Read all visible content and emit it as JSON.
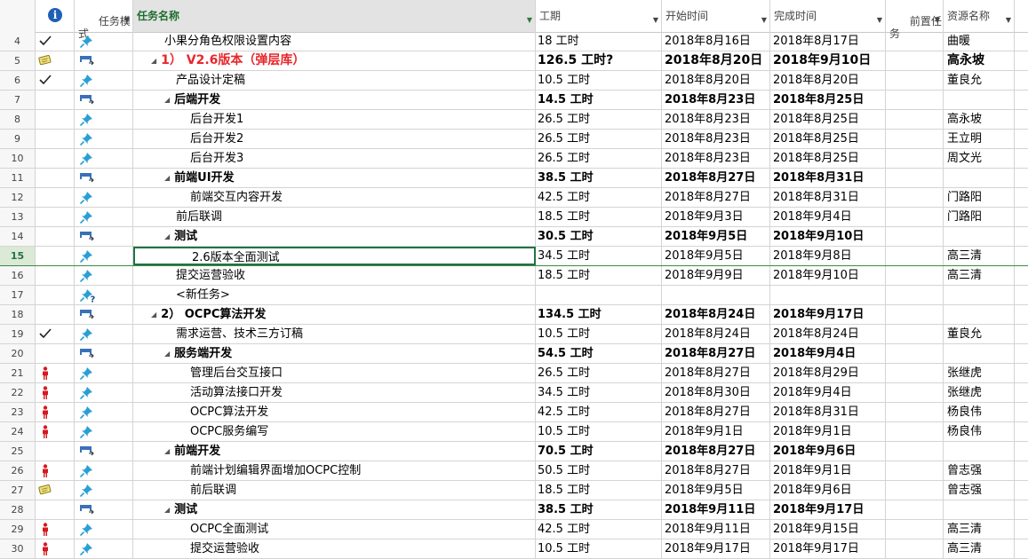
{
  "headers": {
    "info": "i",
    "mode": "任务模\n式",
    "name": "任务名称",
    "duration": "工期",
    "start": "开始时间",
    "finish": "完成时间",
    "pred": "前置任\n务",
    "resource": "资源名称"
  },
  "selected_row": 15,
  "rows": [
    {
      "id": "4",
      "ind": "check",
      "mode": "manual",
      "indent": 2,
      "tri": false,
      "name": "小果分角色权限设置内容",
      "dur": "18 工时",
      "start": "2018年8月16日",
      "fin": "2018年8月17日",
      "res": "曲暖",
      "style": "normal"
    },
    {
      "id": "5",
      "ind": "note",
      "mode": "summary",
      "indent": 1,
      "tri": true,
      "name": "1） V2.6版本（弹层库）",
      "dur": "126.5 工时?",
      "start": "2018年8月20日",
      "fin": "2018年9月10日",
      "res": "高永坡",
      "style": "big"
    },
    {
      "id": "6",
      "ind": "check",
      "mode": "manual",
      "indent": 3,
      "tri": false,
      "name": "产品设计定稿",
      "dur": "10.5 工时",
      "start": "2018年8月20日",
      "fin": "2018年8月20日",
      "res": "董良允",
      "style": "normal"
    },
    {
      "id": "7",
      "ind": "",
      "mode": "summary",
      "indent": 2,
      "tri": true,
      "name": "后端开发",
      "dur": "14.5 工时",
      "start": "2018年8月23日",
      "fin": "2018年8月25日",
      "res": "",
      "style": "bold"
    },
    {
      "id": "8",
      "ind": "",
      "mode": "manual",
      "indent": 4,
      "tri": false,
      "name": "后台开发1",
      "dur": "26.5 工时",
      "start": "2018年8月23日",
      "fin": "2018年8月25日",
      "res": "高永坡",
      "style": "normal"
    },
    {
      "id": "9",
      "ind": "",
      "mode": "manual",
      "indent": 4,
      "tri": false,
      "name": "后台开发2",
      "dur": "26.5 工时",
      "start": "2018年8月23日",
      "fin": "2018年8月25日",
      "res": "王立明",
      "style": "normal"
    },
    {
      "id": "10",
      "ind": "",
      "mode": "manual",
      "indent": 4,
      "tri": false,
      "name": "后台开发3",
      "dur": "26.5 工时",
      "start": "2018年8月23日",
      "fin": "2018年8月25日",
      "res": "周文光",
      "style": "normal"
    },
    {
      "id": "11",
      "ind": "",
      "mode": "summary",
      "indent": 2,
      "tri": true,
      "name": "前端UI开发",
      "dur": "38.5 工时",
      "start": "2018年8月27日",
      "fin": "2018年8月31日",
      "res": "",
      "style": "bold"
    },
    {
      "id": "12",
      "ind": "",
      "mode": "manual",
      "indent": 4,
      "tri": false,
      "name": "前端交互内容开发",
      "dur": "42.5 工时",
      "start": "2018年8月27日",
      "fin": "2018年8月31日",
      "res": "门路阳",
      "style": "normal"
    },
    {
      "id": "13",
      "ind": "",
      "mode": "manual",
      "indent": 3,
      "tri": false,
      "name": "前后联调",
      "dur": "18.5 工时",
      "start": "2018年9月3日",
      "fin": "2018年9月4日",
      "res": "门路阳",
      "style": "normal"
    },
    {
      "id": "14",
      "ind": "",
      "mode": "summary",
      "indent": 2,
      "tri": true,
      "name": "测试",
      "dur": "30.5 工时",
      "start": "2018年9月5日",
      "fin": "2018年9月10日",
      "res": "",
      "style": "bold"
    },
    {
      "id": "15",
      "ind": "",
      "mode": "manual",
      "indent": 4,
      "tri": false,
      "name": "2.6版本全面测试",
      "dur": "34.5 工时",
      "start": "2018年9月5日",
      "fin": "2018年9月8日",
      "res": "高三清",
      "style": "normal"
    },
    {
      "id": "16",
      "ind": "",
      "mode": "manual",
      "indent": 3,
      "tri": false,
      "name": "提交运营验收",
      "dur": "18.5 工时",
      "start": "2018年9月9日",
      "fin": "2018年9月10日",
      "res": "高三清",
      "style": "normal"
    },
    {
      "id": "17",
      "ind": "",
      "mode": "newtask",
      "indent": 3,
      "tri": false,
      "name": "<新任务>",
      "dur": "",
      "start": "",
      "fin": "",
      "res": "",
      "style": "normal"
    },
    {
      "id": "18",
      "ind": "",
      "mode": "summary",
      "indent": 1,
      "tri": true,
      "name": "2） OCPC算法开发",
      "dur": "134.5 工时",
      "start": "2018年8月24日",
      "fin": "2018年9月17日",
      "res": "",
      "style": "bold"
    },
    {
      "id": "19",
      "ind": "check",
      "mode": "manual",
      "indent": 3,
      "tri": false,
      "name": "需求运营、技术三方订稿",
      "dur": "10.5 工时",
      "start": "2018年8月24日",
      "fin": "2018年8月24日",
      "res": "董良允",
      "style": "normal"
    },
    {
      "id": "20",
      "ind": "",
      "mode": "summary",
      "indent": 2,
      "tri": true,
      "name": "服务端开发",
      "dur": "54.5 工时",
      "start": "2018年8月27日",
      "fin": "2018年9月4日",
      "res": "",
      "style": "bold"
    },
    {
      "id": "21",
      "ind": "person",
      "mode": "manual",
      "indent": 4,
      "tri": false,
      "name": "管理后台交互接口",
      "dur": "26.5 工时",
      "start": "2018年8月27日",
      "fin": "2018年8月29日",
      "res": "张继虎",
      "style": "normal"
    },
    {
      "id": "22",
      "ind": "person",
      "mode": "manual",
      "indent": 4,
      "tri": false,
      "name": "活动算法接口开发",
      "dur": "34.5 工时",
      "start": "2018年8月30日",
      "fin": "2018年9月4日",
      "res": "张继虎",
      "style": "normal"
    },
    {
      "id": "23",
      "ind": "person",
      "mode": "manual",
      "indent": 4,
      "tri": false,
      "name": "OCPC算法开发",
      "dur": "42.5 工时",
      "start": "2018年8月27日",
      "fin": "2018年8月31日",
      "res": "杨良伟",
      "style": "normal"
    },
    {
      "id": "24",
      "ind": "person",
      "mode": "manual",
      "indent": 4,
      "tri": false,
      "name": "OCPC服务编写",
      "dur": "10.5 工时",
      "start": "2018年9月1日",
      "fin": "2018年9月1日",
      "res": "杨良伟",
      "style": "normal"
    },
    {
      "id": "25",
      "ind": "",
      "mode": "summary",
      "indent": 2,
      "tri": true,
      "name": "前端开发",
      "dur": "70.5 工时",
      "start": "2018年8月27日",
      "fin": "2018年9月6日",
      "res": "",
      "style": "bold"
    },
    {
      "id": "26",
      "ind": "person",
      "mode": "manual",
      "indent": 4,
      "tri": false,
      "name": "前端计划编辑界面增加OCPC控制",
      "dur": "50.5 工时",
      "start": "2018年8月27日",
      "fin": "2018年9月1日",
      "res": "曾志强",
      "style": "normal"
    },
    {
      "id": "27",
      "ind": "note",
      "mode": "manual",
      "indent": 4,
      "tri": false,
      "name": "前后联调",
      "dur": "18.5 工时",
      "start": "2018年9月5日",
      "fin": "2018年9月6日",
      "res": "曾志强",
      "style": "normal"
    },
    {
      "id": "28",
      "ind": "",
      "mode": "summary",
      "indent": 2,
      "tri": true,
      "name": "测试",
      "dur": "38.5 工时",
      "start": "2018年9月11日",
      "fin": "2018年9月17日",
      "res": "",
      "style": "bold"
    },
    {
      "id": "29",
      "ind": "person",
      "mode": "manual",
      "indent": 4,
      "tri": false,
      "name": "OCPC全面测试",
      "dur": "42.5 工时",
      "start": "2018年9月11日",
      "fin": "2018年9月15日",
      "res": "高三清",
      "style": "normal"
    },
    {
      "id": "30",
      "ind": "person",
      "mode": "manual",
      "indent": 4,
      "tri": false,
      "name": "提交运营验收",
      "dur": "10.5 工时",
      "start": "2018年9月17日",
      "fin": "2018年9月17日",
      "res": "高三清",
      "style": "normal"
    }
  ]
}
